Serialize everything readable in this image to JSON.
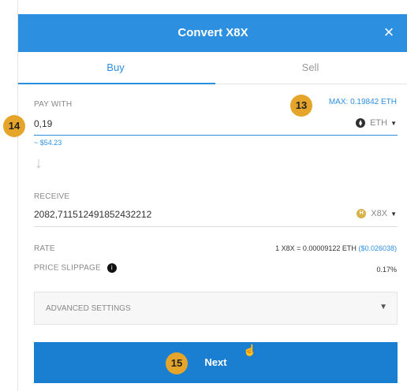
{
  "header": {
    "title": "Convert X8X",
    "close": "×"
  },
  "tabs": {
    "buy": "Buy",
    "sell": "Sell"
  },
  "pay": {
    "label": "PAY WITH",
    "max": "MAX: 0.19842 ETH",
    "value": "0,19",
    "currency": "ETH",
    "usd": "~ $54.23"
  },
  "receive": {
    "label": "RECEIVE",
    "value": "2082,711512491852432212",
    "currency": "X8X",
    "currency_icon_letter": "H"
  },
  "rate": {
    "label": "RATE",
    "value": "1 X8X = 0.00009122 ETH",
    "usd": "($0.026038)"
  },
  "slippage": {
    "label": "PRICE SLIPPAGE",
    "info": "i",
    "value": "0.17%"
  },
  "advanced": {
    "label": "ADVANCED SETTINGS"
  },
  "next": {
    "label": "Next"
  },
  "annotations": {
    "a13": "13",
    "a14": "14",
    "a15": "15"
  },
  "colors": {
    "accent": "#2d8fe0",
    "button": "#1a7fd1",
    "badge": "#e5a52a"
  }
}
